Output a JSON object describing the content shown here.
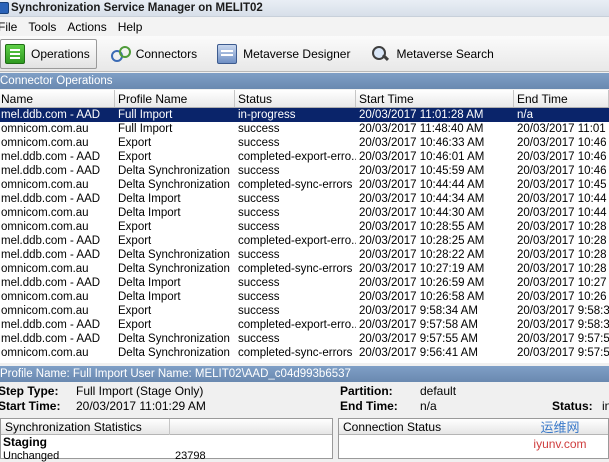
{
  "window": {
    "title": "Synchronization Service Manager on MELIT02"
  },
  "menu": [
    "File",
    "Tools",
    "Actions",
    "Help"
  ],
  "toolbar": [
    {
      "label": "Operations",
      "icon": "operations-icon"
    },
    {
      "label": "Connectors",
      "icon": "connectors-icon"
    },
    {
      "label": "Metaverse Designer",
      "icon": "metaverse-designer-icon"
    },
    {
      "label": "Metaverse Search",
      "icon": "metaverse-search-icon"
    }
  ],
  "operations": {
    "header": "Connector Operations",
    "columns": [
      "Name",
      "Profile Name",
      "Status",
      "Start Time",
      "End Time"
    ],
    "rows": [
      [
        "mel.ddb.com - AAD",
        "Full Import",
        "in-progress",
        "20/03/2017 11:01:28 AM",
        "n/a"
      ],
      [
        "omnicom.com.au",
        "Full Import",
        "success",
        "20/03/2017 11:48:40 AM",
        "20/03/2017 11:01"
      ],
      [
        "omnicom.com.au",
        "Export",
        "success",
        "20/03/2017 10:46:33 AM",
        "20/03/2017 10:46"
      ],
      [
        "mel.ddb.com - AAD",
        "Export",
        "completed-export-erro...",
        "20/03/2017 10:46:01 AM",
        "20/03/2017 10:46"
      ],
      [
        "mel.ddb.com - AAD",
        "Delta Synchronization",
        "success",
        "20/03/2017 10:45:59 AM",
        "20/03/2017 10:46"
      ],
      [
        "omnicom.com.au",
        "Delta Synchronization",
        "completed-sync-errors",
        "20/03/2017 10:44:44 AM",
        "20/03/2017 10:45"
      ],
      [
        "mel.ddb.com - AAD",
        "Delta Import",
        "success",
        "20/03/2017 10:44:34 AM",
        "20/03/2017 10:44"
      ],
      [
        "omnicom.com.au",
        "Delta Import",
        "success",
        "20/03/2017 10:44:30 AM",
        "20/03/2017 10:44"
      ],
      [
        "omnicom.com.au",
        "Export",
        "success",
        "20/03/2017 10:28:55 AM",
        "20/03/2017 10:28"
      ],
      [
        "mel.ddb.com - AAD",
        "Export",
        "completed-export-erro...",
        "20/03/2017 10:28:25 AM",
        "20/03/2017 10:28"
      ],
      [
        "mel.ddb.com - AAD",
        "Delta Synchronization",
        "success",
        "20/03/2017 10:28:22 AM",
        "20/03/2017 10:28"
      ],
      [
        "omnicom.com.au",
        "Delta Synchronization",
        "completed-sync-errors",
        "20/03/2017 10:27:19 AM",
        "20/03/2017 10:28"
      ],
      [
        "mel.ddb.com - AAD",
        "Delta Import",
        "success",
        "20/03/2017 10:26:59 AM",
        "20/03/2017 10:27"
      ],
      [
        "omnicom.com.au",
        "Delta Import",
        "success",
        "20/03/2017 10:26:58 AM",
        "20/03/2017 10:26"
      ],
      [
        "omnicom.com.au",
        "Export",
        "success",
        "20/03/2017 9:58:34 AM",
        "20/03/2017 9:58:3"
      ],
      [
        "mel.ddb.com - AAD",
        "Export",
        "completed-export-erro...",
        "20/03/2017 9:57:58 AM",
        "20/03/2017 9:58:3"
      ],
      [
        "mel.ddb.com - AAD",
        "Delta Synchronization",
        "success",
        "20/03/2017 9:57:55 AM",
        "20/03/2017 9:57:5"
      ],
      [
        "omnicom.com.au",
        "Delta Synchronization",
        "completed-sync-errors",
        "20/03/2017 9:56:41 AM",
        "20/03/2017 9:57:5"
      ]
    ]
  },
  "profile": {
    "header": "Profile Name: Full Import  User Name: MELIT02\\AAD_c04d993b6537",
    "step_type_label": "Step Type:",
    "step_type": "Full Import (Stage Only)",
    "start_time_label": "Start Time:",
    "start_time": "20/03/2017 11:01:29 AM",
    "partition_label": "Partition:",
    "partition": "default",
    "end_time_label": "End Time:",
    "end_time": "n/a",
    "status_label": "Status:",
    "status": "in"
  },
  "stats": {
    "header": "Synchronization Statistics",
    "group": "Staging",
    "unchanged_label": "Unchanged",
    "unchanged_value": "23798"
  },
  "connection": {
    "header": "Connection Status"
  },
  "watermark": {
    "line1": "运维网",
    "line2": "iyunv.com"
  }
}
